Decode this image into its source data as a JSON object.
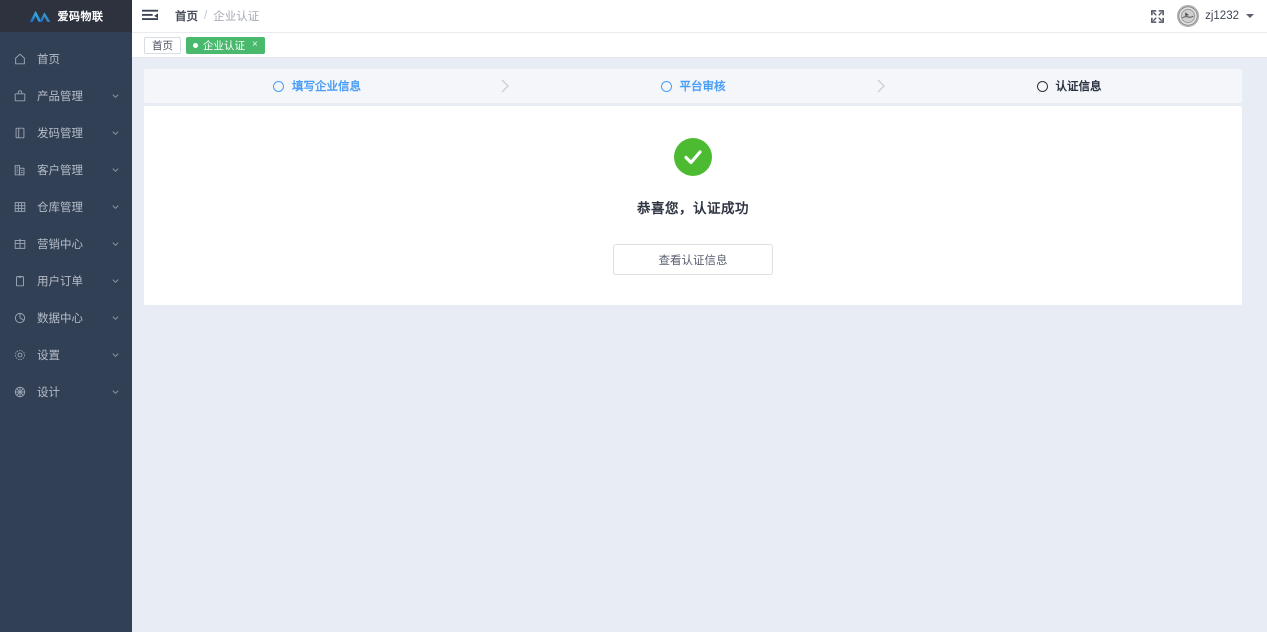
{
  "brand": {
    "name": "爱码物联",
    "logo_icon": "mountain-aa-logo"
  },
  "sidebar": {
    "items": [
      {
        "label": "首页",
        "icon": "home-icon",
        "has_caret": false
      },
      {
        "label": "产品管理",
        "icon": "bag-icon",
        "has_caret": true
      },
      {
        "label": "发码管理",
        "icon": "book-icon",
        "has_caret": true
      },
      {
        "label": "客户管理",
        "icon": "building-icon",
        "has_caret": true
      },
      {
        "label": "仓库管理",
        "icon": "grid-icon",
        "has_caret": true
      },
      {
        "label": "营销中心",
        "icon": "table-icon",
        "has_caret": true
      },
      {
        "label": "用户订单",
        "icon": "clipboard-icon",
        "has_caret": true
      },
      {
        "label": "数据中心",
        "icon": "pie-chart-icon",
        "has_caret": true
      },
      {
        "label": "设置",
        "icon": "gear-icon",
        "has_caret": true
      },
      {
        "label": "设计",
        "icon": "palette-icon",
        "has_caret": true
      }
    ]
  },
  "topbar": {
    "menu_icon": "hamburger-collapse-icon",
    "breadcrumb": {
      "home": "首页",
      "separator": "/",
      "current": "企业认证"
    },
    "fullscreen_icon": "fullscreen-expand-icon",
    "user": {
      "name": "zj1232",
      "avatar_icon": "user-avatar",
      "caret_icon": "chevron-down-icon"
    }
  },
  "tabs": [
    {
      "label": "首页",
      "active": false,
      "closable": false
    },
    {
      "label": "企业认证",
      "active": true,
      "closable": true,
      "close_label": "×"
    }
  ],
  "steps": [
    {
      "label": "填写企业信息",
      "state": "done"
    },
    {
      "label": "平台审核",
      "state": "done"
    },
    {
      "label": "认证信息",
      "state": "current"
    }
  ],
  "step_arrow_icon": "chevron-right-icon",
  "result": {
    "icon": "check-circle-success-icon",
    "title": "恭喜您，认证成功",
    "button_label": "查看认证信息"
  },
  "colors": {
    "sidebar_bg": "#324055",
    "sidebar_header_bg": "#2e323f",
    "page_bg": "#e8ecf5",
    "tab_active": "#49b96d",
    "step_done": "#4a9ef8",
    "step_current": "#2b3343",
    "success_green": "#4cbb31",
    "card_bg": "#ffffff",
    "steps_bg": "#f4f6fa"
  }
}
